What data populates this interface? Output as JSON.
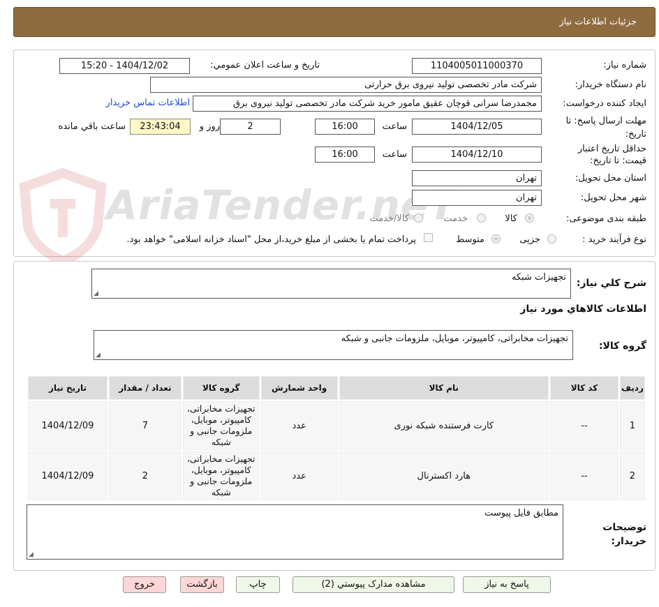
{
  "header": {
    "title": "جزئیات اطلاعات نیاز"
  },
  "watermark": {
    "text": "AriaTender.neT"
  },
  "form": {
    "need_number_label": "شماره نیاز:",
    "need_number": "1104005011000370",
    "announce_label": "تاریخ و ساعت اعلان عمومي:",
    "announce_value": "1404/12/02 - 15:20",
    "buyer_org_label": "نام دستگاه خریدار:",
    "buyer_org": "شرکت مادر تخصصی تولید نیروی برق حرارتی",
    "creator_label": "ایجاد کننده درخواست:",
    "creator": "محمدرضا سرانی قوچان عقیق مامور خرید شرکت مادر تخصصی تولید نیروی برق",
    "contact_link": "اطلاعات تماس خریدار",
    "deadline_label": "مهلت ارسال پاسخ: تا تاریخ:",
    "deadline_date": "1404/12/05",
    "time_label": "ساعت",
    "deadline_time": "16:00",
    "days_value": "2",
    "days_label": "روز و",
    "remaining_time": "23:43:04",
    "remaining_label": "ساعت باقي مانده",
    "validity_label": "حداقل تاریخ اعتبار قیمت: تا تاریخ:",
    "validity_date": "1404/12/10",
    "validity_time": "16:00",
    "province_label": "استان محل تحویل:",
    "province": "تهران",
    "city_label": "شهر محل تحویل:",
    "city": "تهران",
    "category_label": "طبقه بندی موضوعی:",
    "category_options": [
      "کالا",
      "خدمت",
      "کالا/خدمت"
    ],
    "process_label": "نوع فرآیند خرید :",
    "process_options": [
      "جزیی",
      "متوسط"
    ],
    "payment_note": "پرداخت تمام یا بخشی از مبلغ خرید،از محل \"اسناد خزانه اسلامی\" خواهد بود."
  },
  "summary": {
    "label": "شرح کلي نیاز:",
    "value": "تجهیزات شبکه"
  },
  "items_section": {
    "title": "اطلاعات کالاهاي مورد نیاز",
    "group_label": "گروه کالا:",
    "group_value": "تجهیزات مخابراتی، کامپیوتر، موبایل، ملزومات جانبی و شبکه"
  },
  "table": {
    "headers": [
      "ردیف",
      "کد کالا",
      "نام کالا",
      "واحد شمارش",
      "گروه کالا",
      "تعداد / مقدار",
      "تاریخ نیاز"
    ],
    "rows": [
      {
        "row": "1",
        "code": "--",
        "name": "کارت فرستنده شبکه نوری",
        "unit": "عدد",
        "group_lines": [
          "تجهیزات مخابراتی،",
          "کامپیوتر، موبایل،",
          "ملزومات جانبی و",
          "شبکه"
        ],
        "qty": "7",
        "date": "1404/12/09"
      },
      {
        "row": "2",
        "code": "--",
        "name": "هارد اکسترنال",
        "unit": "عدد",
        "group_lines": [
          "تجهیزات مخابراتی،",
          "کامپیوتر، موبایل،",
          "ملزومات جانبی و",
          "شبکه"
        ],
        "qty": "2",
        "date": "1404/12/09"
      }
    ]
  },
  "buyer_notes": {
    "label_line1": "توضیحات",
    "label_line2": "خریدار:",
    "value": "مطابق فایل پیوست"
  },
  "buttons": {
    "reply": "پاسخ به نیاز",
    "attachments": "مشاهده مدارک پیوستي (2)",
    "print": "چاپ",
    "back": "بازگشت",
    "exit": "خروج"
  }
}
